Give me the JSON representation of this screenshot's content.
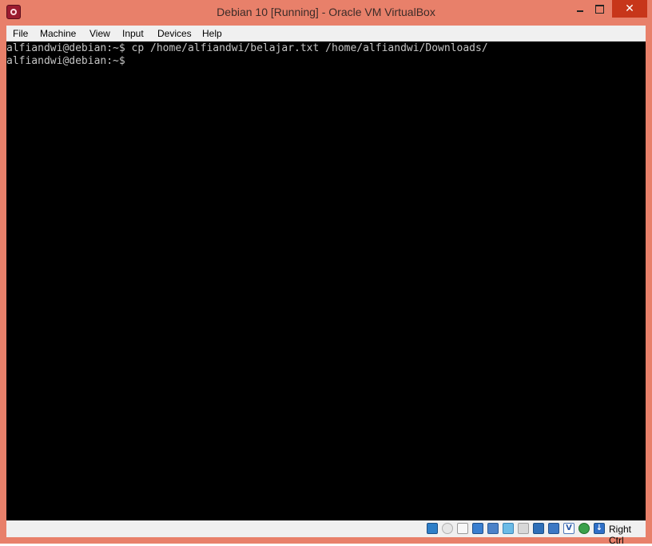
{
  "window": {
    "title": "Debian 10 [Running] - Oracle VM VirtualBox",
    "accent": "#e8806a",
    "close_color": "#c7361a"
  },
  "menubar": {
    "items": [
      "File",
      "Machine",
      "View",
      "Input",
      "Devices",
      "Help"
    ]
  },
  "terminal": {
    "lines": [
      "alfiandwi@debian:~$ cp /home/alfiandwi/belajar.txt /home/alfiandwi/Downloads/",
      "alfiandwi@debian:~$"
    ]
  },
  "statusbar": {
    "icons": [
      "hard-disk-icon",
      "optical-drive-icon",
      "audio-icon",
      "network-icon",
      "usb-icon",
      "shared-folders-icon",
      "display-icon",
      "video-capture-icon",
      "virtualization-icon",
      "cpu-icon",
      "mouse-integration-icon",
      "keyboard-capture-icon"
    ],
    "host_key": "Right Ctrl"
  }
}
